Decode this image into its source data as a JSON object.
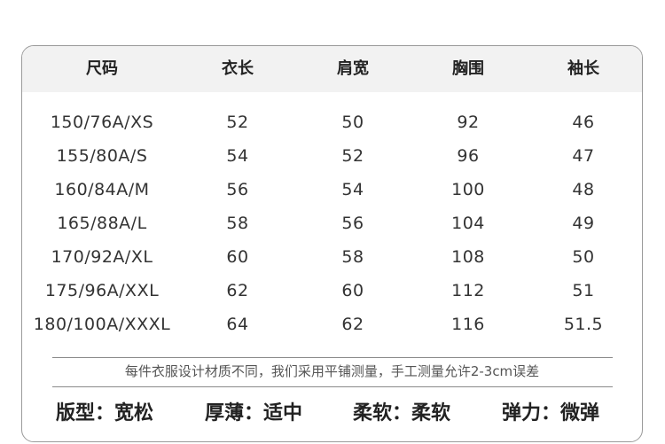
{
  "table": {
    "headers": [
      "尺码",
      "衣长",
      "肩宽",
      "胸围",
      "袖长"
    ],
    "rows": [
      [
        "150/76A/XS",
        "52",
        "50",
        "92",
        "46"
      ],
      [
        "155/80A/S",
        "54",
        "52",
        "96",
        "47"
      ],
      [
        "160/84A/M",
        "56",
        "54",
        "100",
        "48"
      ],
      [
        "165/88A/L",
        "58",
        "56",
        "104",
        "49"
      ],
      [
        "170/92A/XL",
        "60",
        "58",
        "108",
        "50"
      ],
      [
        "175/96A/XXL",
        "62",
        "60",
        "112",
        "51"
      ],
      [
        "180/100A/XXXL",
        "64",
        "62",
        "116",
        "51.5"
      ]
    ]
  },
  "note": "每件衣服设计材质不同，我们采用平铺测量，手工测量允许2-3cm误差",
  "attributes": [
    "版型：宽松",
    "厚薄：适中",
    "柔软：柔软",
    "弹力：微弹"
  ],
  "colors": {
    "header_bg": "#f2f2f2",
    "border": "#9a9a9a"
  }
}
